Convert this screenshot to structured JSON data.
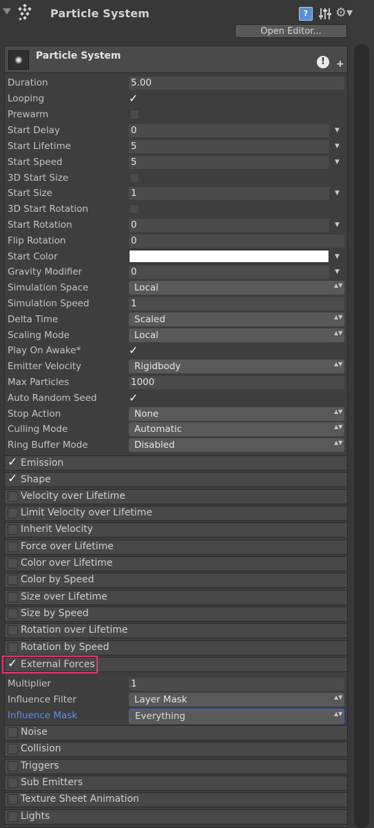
{
  "component": {
    "title": "Particle System",
    "open_editor_label": "Open Editor...",
    "help_glyph": "?",
    "gear_glyph": "⚙▾"
  },
  "main_module": {
    "title": "Particle System",
    "warning_glyph": "!",
    "add_glyph": "+"
  },
  "properties": {
    "duration": {
      "label": "Duration",
      "value": "5.00"
    },
    "looping": {
      "label": "Looping",
      "checked": true
    },
    "prewarm": {
      "label": "Prewarm",
      "checked": false
    },
    "start_delay": {
      "label": "Start Delay",
      "value": "0"
    },
    "start_lifetime": {
      "label": "Start Lifetime",
      "value": "5"
    },
    "start_speed": {
      "label": "Start Speed",
      "value": "5"
    },
    "start_size_3d": {
      "label": "3D Start Size",
      "checked": false
    },
    "start_size": {
      "label": "Start Size",
      "value": "1"
    },
    "start_rotation_3d": {
      "label": "3D Start Rotation",
      "checked": false
    },
    "start_rotation": {
      "label": "Start Rotation",
      "value": "0"
    },
    "flip_rotation": {
      "label": "Flip Rotation",
      "value": "0"
    },
    "start_color": {
      "label": "Start Color",
      "color": "#ffffff"
    },
    "gravity_modifier": {
      "label": "Gravity Modifier",
      "value": "0"
    },
    "simulation_space": {
      "label": "Simulation Space",
      "value": "Local"
    },
    "simulation_speed": {
      "label": "Simulation Speed",
      "value": "1"
    },
    "delta_time": {
      "label": "Delta Time",
      "value": "Scaled"
    },
    "scaling_mode": {
      "label": "Scaling Mode",
      "value": "Local"
    },
    "play_on_awake": {
      "label": "Play On Awake*",
      "checked": true
    },
    "emitter_velocity": {
      "label": "Emitter Velocity",
      "value": "Rigidbody"
    },
    "max_particles": {
      "label": "Max Particles",
      "value": "1000"
    },
    "auto_random_seed": {
      "label": "Auto Random Seed",
      "checked": true
    },
    "stop_action": {
      "label": "Stop Action",
      "value": "None"
    },
    "culling_mode": {
      "label": "Culling Mode",
      "value": "Automatic"
    },
    "ring_buffer_mode": {
      "label": "Ring Buffer Mode",
      "value": "Disabled"
    }
  },
  "modules": [
    {
      "label": "Emission",
      "enabled": true
    },
    {
      "label": "Shape",
      "enabled": true
    },
    {
      "label": "Velocity over Lifetime",
      "enabled": false
    },
    {
      "label": "Limit Velocity over Lifetime",
      "enabled": false
    },
    {
      "label": "Inherit Velocity",
      "enabled": false
    },
    {
      "label": "Force over Lifetime",
      "enabled": false
    },
    {
      "label": "Color over Lifetime",
      "enabled": false
    },
    {
      "label": "Color by Speed",
      "enabled": false
    },
    {
      "label": "Size over Lifetime",
      "enabled": false
    },
    {
      "label": "Size by Speed",
      "enabled": false
    },
    {
      "label": "Rotation over Lifetime",
      "enabled": false
    },
    {
      "label": "Rotation by Speed",
      "enabled": false
    },
    {
      "label": "External Forces",
      "enabled": true
    }
  ],
  "external_forces": {
    "multiplier": {
      "label": "Multiplier",
      "value": "1"
    },
    "influence_filter": {
      "label": "Influence Filter",
      "value": "Layer Mask"
    },
    "influence_mask": {
      "label": "Influence Mask",
      "value": "Everything"
    }
  },
  "modules_after": [
    {
      "label": "Noise",
      "enabled": false
    },
    {
      "label": "Collision",
      "enabled": false
    },
    {
      "label": "Triggers",
      "enabled": false
    },
    {
      "label": "Sub Emitters",
      "enabled": false
    },
    {
      "label": "Texture Sheet Animation",
      "enabled": false
    },
    {
      "label": "Lights",
      "enabled": false
    }
  ],
  "glyphs": {
    "check": "✓",
    "curve_arrow": "▼",
    "dropdown_arrows": "▲▼"
  },
  "colors": {
    "highlight": "#e8357a",
    "active_label": "#5b8df3",
    "focus_border": "#3a64e0"
  }
}
